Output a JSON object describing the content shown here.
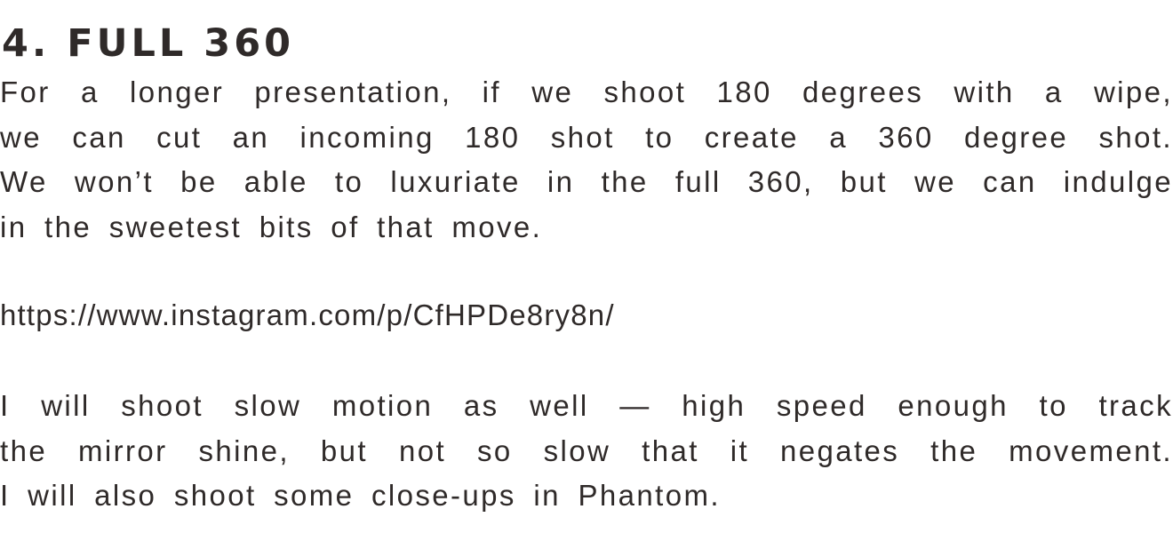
{
  "heading": "4. FULL 360",
  "paragraphs": [
    {
      "lines": [
        "For a longer presentation, if we shoot 180 degrees with a wipe,",
        "we can cut an incoming 180 shot to create a 360 degree shot.",
        "We won’t be able to luxuriate in the full 360, but we can indulge",
        "in the sweetest bits of that move."
      ]
    },
    {
      "lines": [
        "https://www.instagram.com/p/CfHPDe8ry8n/"
      ]
    },
    {
      "lines": [
        "I will shoot slow motion as well — high speed enough to track",
        "the mirror shine, but not so slow that it negates the movement.",
        "I will also shoot some close-ups in Phantom."
      ]
    }
  ]
}
